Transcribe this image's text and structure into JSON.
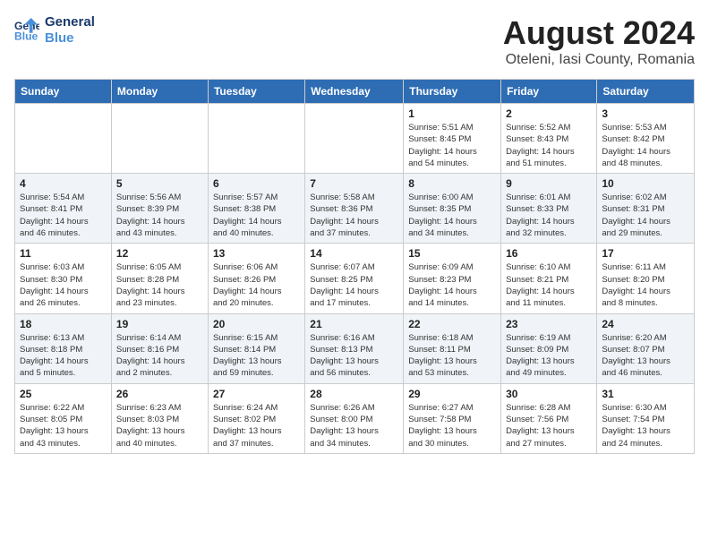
{
  "header": {
    "logo_line1": "General",
    "logo_line2": "Blue",
    "month_year": "August 2024",
    "location": "Oteleni, Iasi County, Romania"
  },
  "weekdays": [
    "Sunday",
    "Monday",
    "Tuesday",
    "Wednesday",
    "Thursday",
    "Friday",
    "Saturday"
  ],
  "weeks": [
    [
      {
        "day": "",
        "info": ""
      },
      {
        "day": "",
        "info": ""
      },
      {
        "day": "",
        "info": ""
      },
      {
        "day": "",
        "info": ""
      },
      {
        "day": "1",
        "info": "Sunrise: 5:51 AM\nSunset: 8:45 PM\nDaylight: 14 hours\nand 54 minutes."
      },
      {
        "day": "2",
        "info": "Sunrise: 5:52 AM\nSunset: 8:43 PM\nDaylight: 14 hours\nand 51 minutes."
      },
      {
        "day": "3",
        "info": "Sunrise: 5:53 AM\nSunset: 8:42 PM\nDaylight: 14 hours\nand 48 minutes."
      }
    ],
    [
      {
        "day": "4",
        "info": "Sunrise: 5:54 AM\nSunset: 8:41 PM\nDaylight: 14 hours\nand 46 minutes."
      },
      {
        "day": "5",
        "info": "Sunrise: 5:56 AM\nSunset: 8:39 PM\nDaylight: 14 hours\nand 43 minutes."
      },
      {
        "day": "6",
        "info": "Sunrise: 5:57 AM\nSunset: 8:38 PM\nDaylight: 14 hours\nand 40 minutes."
      },
      {
        "day": "7",
        "info": "Sunrise: 5:58 AM\nSunset: 8:36 PM\nDaylight: 14 hours\nand 37 minutes."
      },
      {
        "day": "8",
        "info": "Sunrise: 6:00 AM\nSunset: 8:35 PM\nDaylight: 14 hours\nand 34 minutes."
      },
      {
        "day": "9",
        "info": "Sunrise: 6:01 AM\nSunset: 8:33 PM\nDaylight: 14 hours\nand 32 minutes."
      },
      {
        "day": "10",
        "info": "Sunrise: 6:02 AM\nSunset: 8:31 PM\nDaylight: 14 hours\nand 29 minutes."
      }
    ],
    [
      {
        "day": "11",
        "info": "Sunrise: 6:03 AM\nSunset: 8:30 PM\nDaylight: 14 hours\nand 26 minutes."
      },
      {
        "day": "12",
        "info": "Sunrise: 6:05 AM\nSunset: 8:28 PM\nDaylight: 14 hours\nand 23 minutes."
      },
      {
        "day": "13",
        "info": "Sunrise: 6:06 AM\nSunset: 8:26 PM\nDaylight: 14 hours\nand 20 minutes."
      },
      {
        "day": "14",
        "info": "Sunrise: 6:07 AM\nSunset: 8:25 PM\nDaylight: 14 hours\nand 17 minutes."
      },
      {
        "day": "15",
        "info": "Sunrise: 6:09 AM\nSunset: 8:23 PM\nDaylight: 14 hours\nand 14 minutes."
      },
      {
        "day": "16",
        "info": "Sunrise: 6:10 AM\nSunset: 8:21 PM\nDaylight: 14 hours\nand 11 minutes."
      },
      {
        "day": "17",
        "info": "Sunrise: 6:11 AM\nSunset: 8:20 PM\nDaylight: 14 hours\nand 8 minutes."
      }
    ],
    [
      {
        "day": "18",
        "info": "Sunrise: 6:13 AM\nSunset: 8:18 PM\nDaylight: 14 hours\nand 5 minutes."
      },
      {
        "day": "19",
        "info": "Sunrise: 6:14 AM\nSunset: 8:16 PM\nDaylight: 14 hours\nand 2 minutes."
      },
      {
        "day": "20",
        "info": "Sunrise: 6:15 AM\nSunset: 8:14 PM\nDaylight: 13 hours\nand 59 minutes."
      },
      {
        "day": "21",
        "info": "Sunrise: 6:16 AM\nSunset: 8:13 PM\nDaylight: 13 hours\nand 56 minutes."
      },
      {
        "day": "22",
        "info": "Sunrise: 6:18 AM\nSunset: 8:11 PM\nDaylight: 13 hours\nand 53 minutes."
      },
      {
        "day": "23",
        "info": "Sunrise: 6:19 AM\nSunset: 8:09 PM\nDaylight: 13 hours\nand 49 minutes."
      },
      {
        "day": "24",
        "info": "Sunrise: 6:20 AM\nSunset: 8:07 PM\nDaylight: 13 hours\nand 46 minutes."
      }
    ],
    [
      {
        "day": "25",
        "info": "Sunrise: 6:22 AM\nSunset: 8:05 PM\nDaylight: 13 hours\nand 43 minutes."
      },
      {
        "day": "26",
        "info": "Sunrise: 6:23 AM\nSunset: 8:03 PM\nDaylight: 13 hours\nand 40 minutes."
      },
      {
        "day": "27",
        "info": "Sunrise: 6:24 AM\nSunset: 8:02 PM\nDaylight: 13 hours\nand 37 minutes."
      },
      {
        "day": "28",
        "info": "Sunrise: 6:26 AM\nSunset: 8:00 PM\nDaylight: 13 hours\nand 34 minutes."
      },
      {
        "day": "29",
        "info": "Sunrise: 6:27 AM\nSunset: 7:58 PM\nDaylight: 13 hours\nand 30 minutes."
      },
      {
        "day": "30",
        "info": "Sunrise: 6:28 AM\nSunset: 7:56 PM\nDaylight: 13 hours\nand 27 minutes."
      },
      {
        "day": "31",
        "info": "Sunrise: 6:30 AM\nSunset: 7:54 PM\nDaylight: 13 hours\nand 24 minutes."
      }
    ]
  ]
}
